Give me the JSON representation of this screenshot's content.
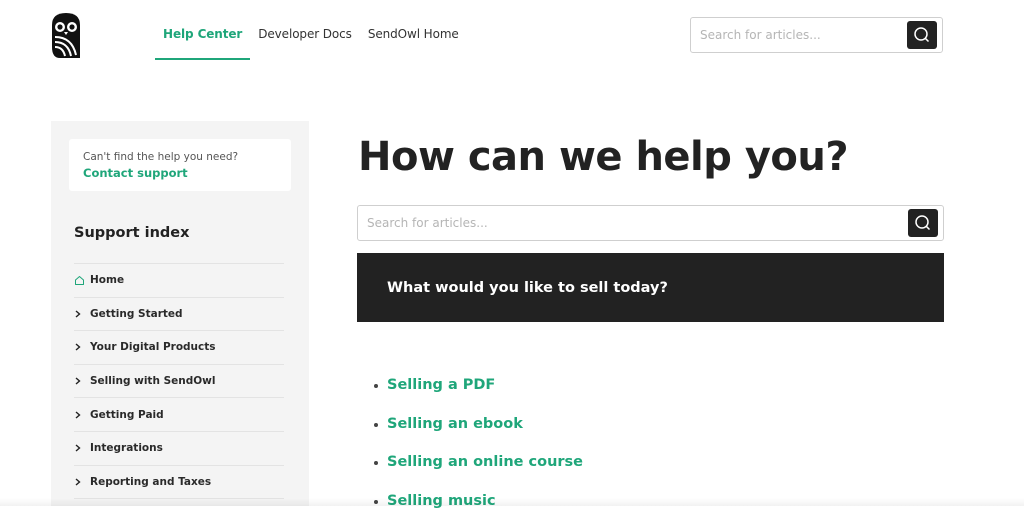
{
  "header": {
    "logo_name": "SendOwl",
    "nav": [
      {
        "label": "Help Center",
        "active": true
      },
      {
        "label": "Developer Docs",
        "active": false
      },
      {
        "label": "SendOwl Home",
        "active": false
      }
    ],
    "search": {
      "placeholder": "Search for articles...",
      "value": ""
    }
  },
  "sidebar": {
    "help_card": {
      "question": "Can't find the help you need?",
      "link": "Contact support"
    },
    "title": "Support index",
    "items": [
      {
        "label": "Home",
        "icon": "home-icon"
      },
      {
        "label": "Getting Started",
        "icon": "chevron-right-icon"
      },
      {
        "label": "Your Digital Products",
        "icon": "chevron-right-icon"
      },
      {
        "label": "Selling with SendOwl",
        "icon": "chevron-right-icon"
      },
      {
        "label": "Getting Paid",
        "icon": "chevron-right-icon"
      },
      {
        "label": "Integrations",
        "icon": "chevron-right-icon"
      },
      {
        "label": "Reporting and Taxes",
        "icon": "chevron-right-icon"
      }
    ]
  },
  "main": {
    "headline": "How can we help you?",
    "search": {
      "placeholder": "Search for articles...",
      "value": ""
    },
    "banner": "What would you like to sell today?",
    "links": [
      {
        "label": "Selling a PDF"
      },
      {
        "label": "Selling an ebook"
      },
      {
        "label": "Selling an online course"
      },
      {
        "label": "Selling music"
      }
    ]
  },
  "colors": {
    "accent": "#1fa67a",
    "dark": "#222222",
    "sidebar_bg": "#f4f4f4"
  }
}
